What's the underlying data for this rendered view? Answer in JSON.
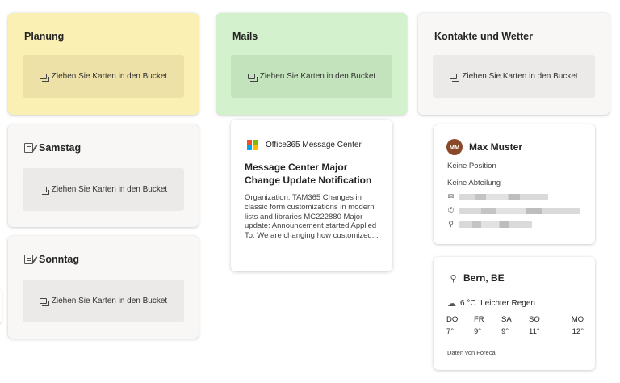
{
  "dropzone_label": "Ziehen Sie Karten in den Bucket",
  "buckets": [
    {
      "title": "Planung",
      "bg": "#fbf0b4",
      "zone_bg": "#ede1a8"
    },
    {
      "title": "Mails",
      "bg": "#d3f1cc",
      "zone_bg": "#c3e3bc"
    },
    {
      "title": "Kontakte und Wetter",
      "bg": "#f8f7f6",
      "zone_bg": "#ebeae8"
    }
  ],
  "days": [
    {
      "title": "Samstag"
    },
    {
      "title": "Sonntag"
    }
  ],
  "mail_card": {
    "source": "Office365 Message Center",
    "subject": "Message Center Major Change Update Notification",
    "body": "Organization: TAM365 Changes in classic form customizations in modern lists and libraries MC222880 Major update: Announcement started Applied To: We are changing how customized..."
  },
  "contact": {
    "initials": "MM",
    "name": "Max Muster",
    "position": "Keine Position",
    "department": "Keine Abteilung",
    "avatar_color": "#8a4a2a"
  },
  "weather": {
    "location": "Bern, BE",
    "current": "6 °C  Leichter Regen",
    "days": [
      "DO",
      "FR",
      "SA",
      "SO",
      "MO"
    ],
    "temps": [
      "7°",
      "9°",
      "9°",
      "11°",
      "12°"
    ],
    "source": "Daten von Foreca"
  }
}
